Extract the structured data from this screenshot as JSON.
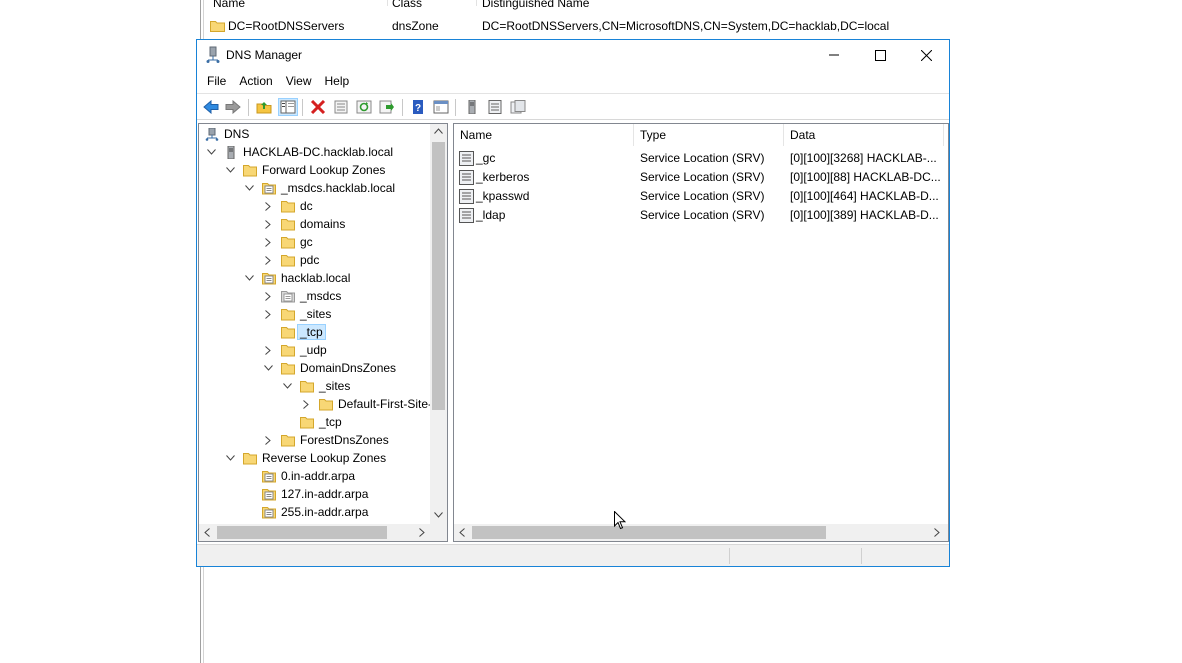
{
  "background_window": {
    "columns": [
      "Name",
      "Class",
      "Distinguished Name"
    ],
    "row": {
      "name": "DC=RootDNSServers",
      "class": "dnsZone",
      "dn": "DC=RootDNSServers,CN=MicrosoftDNS,CN=System,DC=hacklab,DC=local"
    }
  },
  "window": {
    "title": "DNS Manager",
    "controls": {
      "minimize": "minimize-icon",
      "maximize": "maximize-icon",
      "close": "close-icon"
    }
  },
  "menu": [
    "File",
    "Action",
    "View",
    "Help"
  ],
  "toolbar": {
    "icons": [
      "back-icon",
      "forward-icon",
      "up-folder-icon",
      "show-hide-tree-icon",
      "delete-icon",
      "properties-icon",
      "refresh-icon",
      "export-list-icon",
      "help-icon",
      "console-icon",
      "server-icon",
      "record-list-icon",
      "zone-icon"
    ]
  },
  "tree": {
    "root": "DNS",
    "server": "HACKLAB-DC.hacklab.local",
    "forward_zones": "Forward Lookup Zones",
    "msdcs_zone": "_msdcs.hacklab.local",
    "msdcs_children": [
      "dc",
      "domains",
      "gc",
      "pdc"
    ],
    "hacklab_zone": "hacklab.local",
    "hacklab_children": [
      "_msdcs",
      "_sites",
      "_tcp",
      "_udp",
      "DomainDnsZones"
    ],
    "domaindns_children": [
      "_sites"
    ],
    "sites_child": "Default-First-Site-",
    "domaindns_tcp": "_tcp",
    "forest_zones": "ForestDnsZones",
    "reverse_zones": "Reverse Lookup Zones",
    "reverse_children": [
      "0.in-addr.arpa",
      "127.in-addr.arpa",
      "255.in-addr.arpa"
    ],
    "selected": "_tcp"
  },
  "details": {
    "columns": [
      "Name",
      "Type",
      "Data"
    ],
    "rows": [
      {
        "name": "_gc",
        "type": "Service Location (SRV)",
        "data": "[0][100][3268] HACKLAB-..."
      },
      {
        "name": "_kerberos",
        "type": "Service Location (SRV)",
        "data": "[0][100][88] HACKLAB-DC..."
      },
      {
        "name": "_kpasswd",
        "type": "Service Location (SRV)",
        "data": "[0][100][464] HACKLAB-D..."
      },
      {
        "name": "_ldap",
        "type": "Service Location (SRV)",
        "data": "[0][100][389] HACKLAB-D..."
      }
    ]
  },
  "colors": {
    "accent": "#1883d7",
    "folder": "#f5c542",
    "selection": "#cce8ff"
  }
}
